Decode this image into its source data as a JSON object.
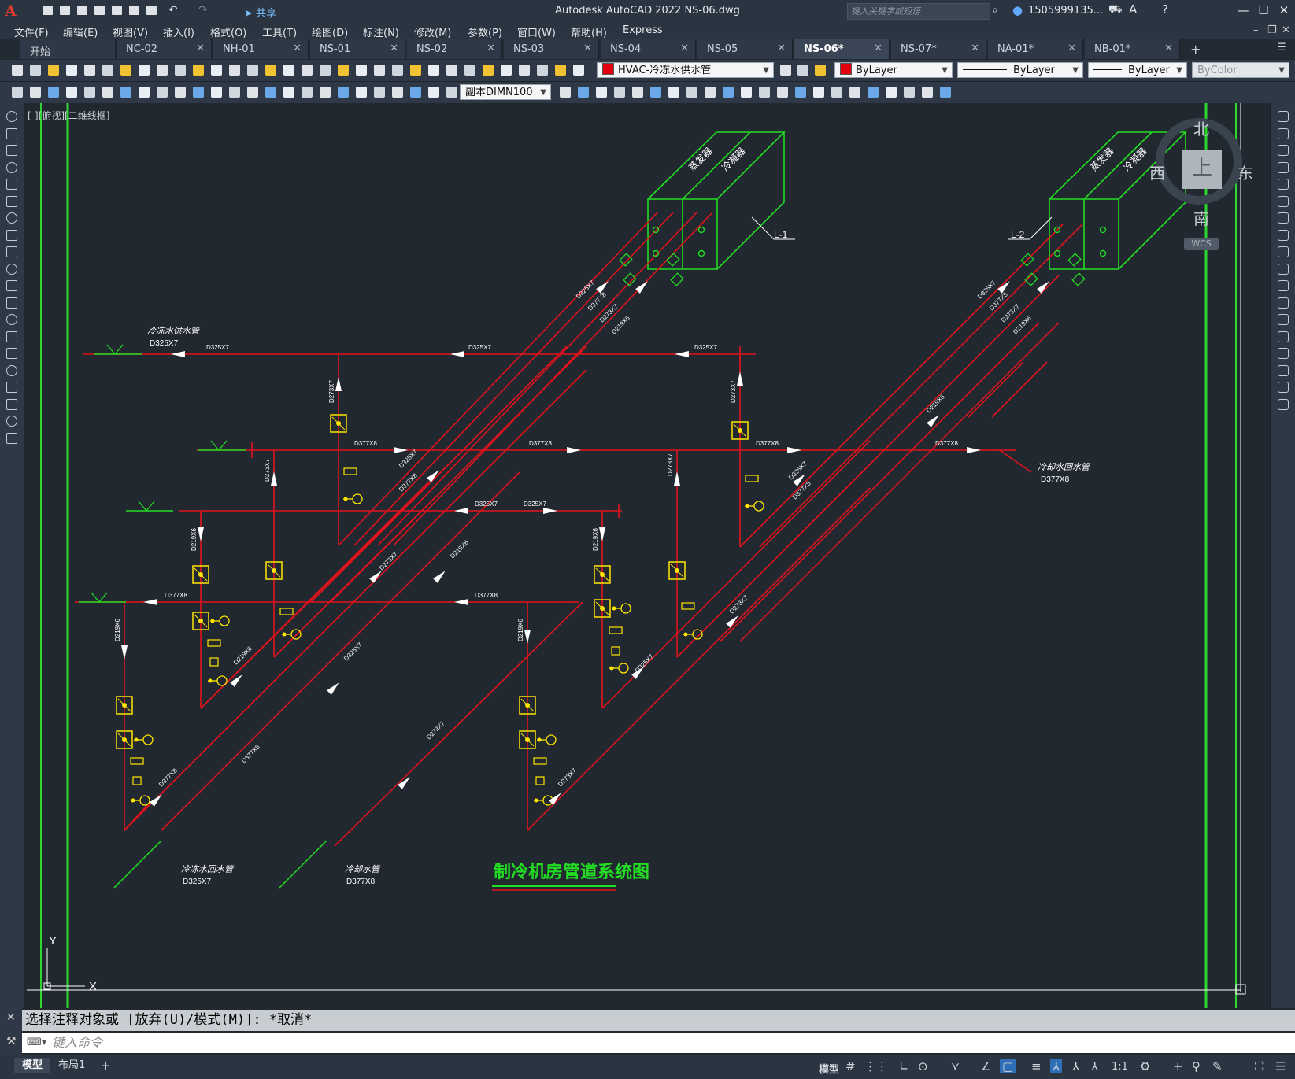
{
  "window": {
    "app_logo": "A",
    "title": "Autodesk AutoCAD 2022    NS-06.dwg",
    "share": "共享",
    "search_placeholder": "键入关键字或短语",
    "user": "1505999135...",
    "minimize": "—",
    "maximize": "☐",
    "close": "✕"
  },
  "menu": [
    "文件(F)",
    "编辑(E)",
    "视图(V)",
    "插入(I)",
    "格式(O)",
    "工具(T)",
    "绘图(D)",
    "标注(N)",
    "修改(M)",
    "参数(P)",
    "窗口(W)",
    "帮助(H)",
    "Express"
  ],
  "tabs": [
    {
      "label": "开始",
      "closable": false
    },
    {
      "label": "NC-02",
      "closable": true
    },
    {
      "label": "NH-01",
      "closable": true
    },
    {
      "label": "NS-01",
      "closable": true
    },
    {
      "label": "NS-02",
      "closable": true
    },
    {
      "label": "NS-03",
      "closable": true
    },
    {
      "label": "NS-04",
      "closable": true
    },
    {
      "label": "NS-05",
      "closable": true
    },
    {
      "label": "NS-06*",
      "closable": true,
      "active": true
    },
    {
      "label": "NS-07*",
      "closable": true
    },
    {
      "label": "NA-01*",
      "closable": true
    },
    {
      "label": "NB-01*",
      "closable": true
    }
  ],
  "tab_add": "+",
  "toolbar": {
    "layer": "HVAC-冷冻水供水管",
    "color": "ByLayer",
    "linetype": "ByLayer",
    "lineweight": "ByLayer",
    "plotstyle": "ByColor",
    "dimstyle": "副本DIMN100",
    "accent_color": "#e3000f"
  },
  "viewport_label": "[-][俯视][二维线框]",
  "viewcube": {
    "top": "上",
    "north": "北",
    "south": "南",
    "east": "东",
    "west": "西",
    "wcs": "WCS"
  },
  "ucs": {
    "x": "X",
    "y": "Y"
  },
  "drawing": {
    "title": "制冷机房管道系统图",
    "equip_left": [
      "蒸发器",
      "冷凝器"
    ],
    "equip_right": [
      "蒸发器",
      "冷凝器"
    ],
    "tag_l1": "L-1",
    "tag_l2": "L-2",
    "supply_label": "冷冻水供水管",
    "supply_size": "D325X7",
    "cooling_return_label": "冷却水回水管",
    "cooling_return_size": "D377X8",
    "chilled_return_label": "冷冻水回水管",
    "chilled_return_size": "D325X7",
    "cooling_supply_label": "冷却水管",
    "cooling_supply_size": "D377X8",
    "pipe_sizes": [
      "D325X7",
      "D377X8",
      "D273X7",
      "D219X6"
    ],
    "colors": {
      "pipe": "#e1131d",
      "equipment": "#22dd22",
      "valve": "#ffe600",
      "arrow": "#ffffff",
      "title": "#22dd22"
    }
  },
  "command": {
    "history": "选择注释对象或 [放弃(U)/模式(M)]: *取消*",
    "input_placeholder": "键入命令"
  },
  "status": {
    "layouts": [
      "模型",
      "布局1"
    ],
    "add_layout": "+",
    "model": "模型",
    "scale": "1:1"
  }
}
